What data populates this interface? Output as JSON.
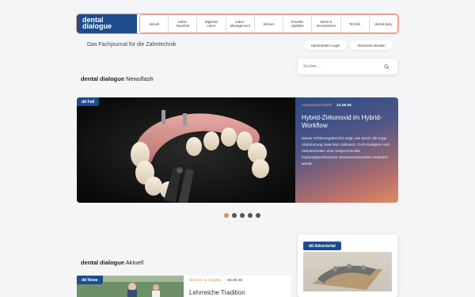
{
  "header": {
    "logo_line1": "dental",
    "logo_line2": "dialogue",
    "nav": [
      "Aktuell",
      "Labor-\nhaushalt",
      "Digitales\nLabor",
      "Labor-\nManagement",
      "Wissen",
      "Produkt-\nUpdates",
      "Markt &\nInnovationen",
      "Technik",
      "dental diary"
    ]
  },
  "tagline": "Das Fachjournal für die Zahntechnik",
  "buttons": {
    "login": "Abonnenten-Login",
    "subscribe": "Abonnent werden"
  },
  "search": {
    "placeholder": "Suchen ..."
  },
  "newsflash": {
    "brand": "dental dialogue",
    "title": "Newsflash"
  },
  "slide": {
    "badge": "dd Fall",
    "category": "Implantatprothetik",
    "date": "21.08.25",
    "title": "Hybrid-Zirkonoxid im Hybrid-Workflow",
    "body": "Dieser Erfahrungsbericht zeigt, wie durch die enge Abstimmung zwischen Zahnarzt, CAD-Designer und Zahntechniker eine anspruchsvolle implantatprothetische Gesamtrestauration realisiert wurde."
  },
  "slider_dots": {
    "count": 5,
    "active_index": 0
  },
  "advertorial": {
    "badge": "dd Advertorial"
  },
  "aktuell": {
    "brand": "dental dialogue",
    "title": "Aktuell"
  },
  "news": {
    "badge": "dd News",
    "category": "Branche & Insights",
    "date": "06.08.25",
    "title": "Lehrreiche Tradition"
  },
  "colors": {
    "brand_blue": "#1d4c8e",
    "accent_orange": "#e08a64"
  }
}
